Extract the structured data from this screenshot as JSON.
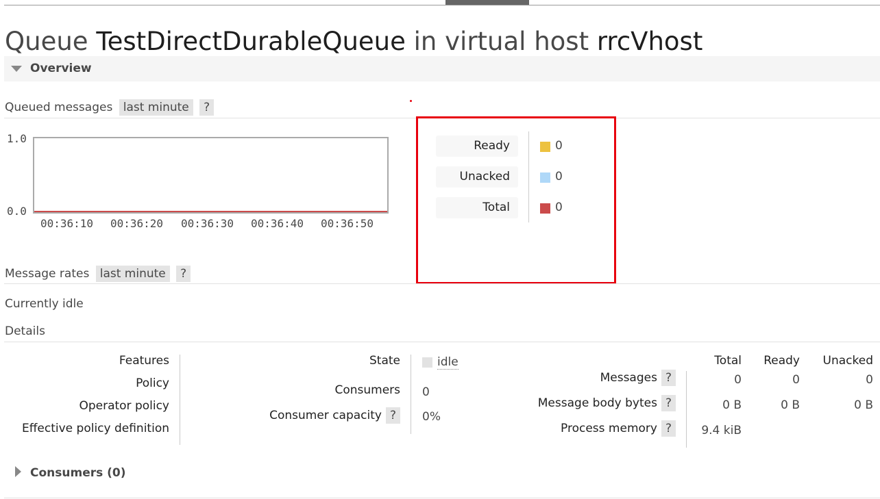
{
  "title": {
    "prefix": "Queue",
    "queue_name": "TestDirectDurableQueue",
    "middle": "in virtual host",
    "vhost": "rrcVhost"
  },
  "overview": {
    "label": "Overview",
    "expanded": true
  },
  "queued_messages": {
    "label": "Queued messages",
    "range_button": "last minute",
    "help": "?"
  },
  "chart_data": {
    "type": "line",
    "x": [
      "00:36:10",
      "00:36:20",
      "00:36:30",
      "00:36:40",
      "00:36:50"
    ],
    "y_ticks": [
      "1.0",
      "0.0"
    ],
    "ylim": [
      0,
      1
    ],
    "series": [
      {
        "name": "Ready",
        "values": [
          0,
          0,
          0,
          0,
          0
        ],
        "color": "#edc240"
      },
      {
        "name": "Unacked",
        "values": [
          0,
          0,
          0,
          0,
          0
        ],
        "color": "#afd8f8"
      },
      {
        "name": "Total",
        "values": [
          0,
          0,
          0,
          0,
          0
        ],
        "color": "#cb4b4b"
      }
    ]
  },
  "legend": [
    {
      "label": "Ready",
      "value": "0",
      "color": "#edc240"
    },
    {
      "label": "Unacked",
      "value": "0",
      "color": "#afd8f8"
    },
    {
      "label": "Total",
      "value": "0",
      "color": "#cb4b4b"
    }
  ],
  "message_rates": {
    "label": "Message rates",
    "range_button": "last minute",
    "help": "?",
    "status": "Currently idle"
  },
  "details": {
    "label": "Details",
    "left_labels": [
      "Features",
      "Policy",
      "Operator policy",
      "Effective policy definition"
    ],
    "state_label": "State",
    "state_value": "idle",
    "consumers_label": "Consumers",
    "consumers_value": "0",
    "capacity_label": "Consumer capacity",
    "capacity_help": "?",
    "capacity_value": "0%",
    "col_headers": [
      "Total",
      "Ready",
      "Unacked"
    ],
    "rows": [
      {
        "label": "Messages",
        "help": "?",
        "values": [
          "0",
          "0",
          "0"
        ]
      },
      {
        "label": "Message body bytes",
        "help": "?",
        "values": [
          "0 B",
          "0 B",
          "0 B"
        ]
      },
      {
        "label": "Process memory",
        "help": "?",
        "values": [
          "9.4 kiB"
        ]
      }
    ]
  },
  "consumers_section": {
    "label": "Consumers (0)",
    "expanded": false
  }
}
